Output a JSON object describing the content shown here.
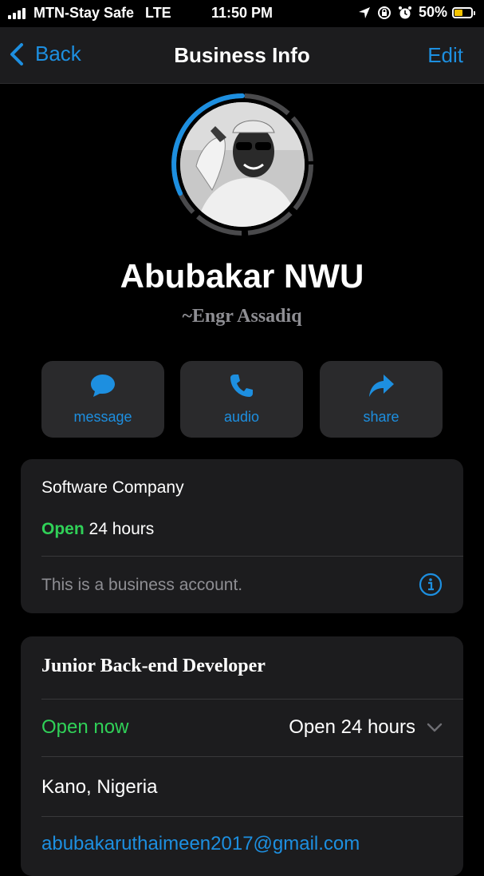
{
  "status_bar": {
    "carrier": "MTN-Stay Safe",
    "network": "LTE",
    "time": "11:50 PM",
    "battery_percent_label": "50%",
    "battery_level": 0.5,
    "icons": [
      "signal-bars-icon",
      "location-arrow-icon",
      "orientation-lock-icon",
      "alarm-icon",
      "battery-icon"
    ],
    "battery_color": "#f5c400"
  },
  "nav": {
    "back_label": "Back",
    "title": "Business Info",
    "edit_label": "Edit"
  },
  "profile": {
    "name": "Abubakar NWU",
    "about": "~Engr Assadiq"
  },
  "actions": [
    {
      "label": "message",
      "icon": "chat-bubble-icon"
    },
    {
      "label": "audio",
      "icon": "phone-icon"
    },
    {
      "label": "share",
      "icon": "share-arrow-icon"
    }
  ],
  "business": {
    "category": "Software Company",
    "open_label": "Open",
    "hours_text": "24 hours",
    "note": "This is a business account."
  },
  "details": {
    "description": "Junior Back-end Developer",
    "open_now": "Open now",
    "hours_summary": "Open 24 hours",
    "location": "Kano, Nigeria",
    "email": "abubakaruthaimeen2017@gmail.com"
  },
  "colors": {
    "accent": "#1d8fe0",
    "open_green": "#30d158",
    "card_bg": "#1c1c1e",
    "button_bg": "#2a2a2c",
    "background": "#000000"
  }
}
